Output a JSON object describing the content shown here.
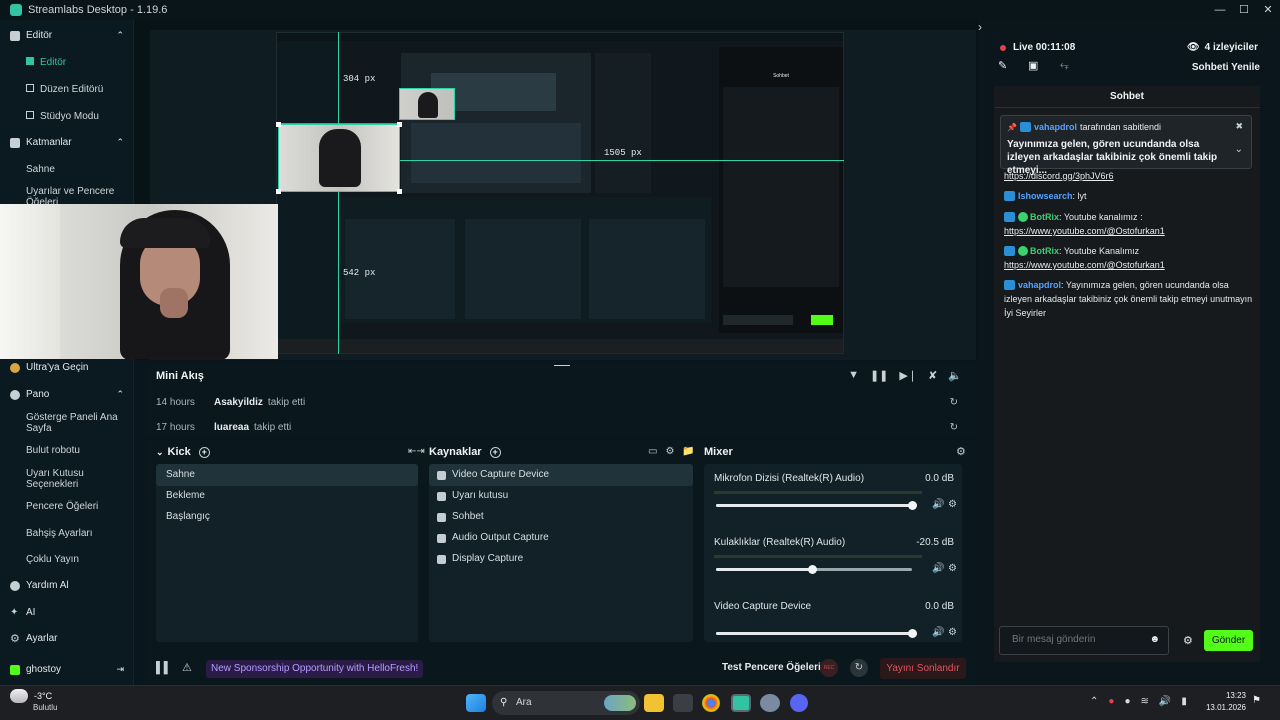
{
  "window": {
    "title": "Streamlabs Desktop - 1.19.6"
  },
  "sidebar": {
    "editor_section": "Editör",
    "editor_items": [
      "Editör",
      "Düzen Editörü",
      "Stüdyo Modu"
    ],
    "layers_section": "Katmanlar",
    "layers_items": [
      "Sahne",
      "Uyarılar ve Pencere Öğeleri"
    ],
    "ultra": "Ultra'ya Geçin",
    "panel_section": "Pano",
    "panel_items": [
      "Gösterge Paneli Ana Sayfa",
      "Bulut robotu",
      "Uyarı Kutusu Seçenekleri",
      "Pencere Öğeleri",
      "Bahşiş Ayarları",
      "Çoklu Yayın"
    ],
    "help": "Yardım Al",
    "ai": "AI",
    "settings": "Ayarlar",
    "user": "ghostoy"
  },
  "preview": {
    "guides": [
      "304 px",
      "1505 px",
      "542 px"
    ],
    "inner_chat_title": "Sohbet"
  },
  "miniflow": {
    "title": "Mini Akış",
    "rows": [
      {
        "time": "14 hours",
        "name": "Asakyildiz",
        "action": "takip etti"
      },
      {
        "time": "17 hours",
        "name": "luareaa",
        "action": "takip etti"
      }
    ]
  },
  "scenes": {
    "title": "Kick",
    "items": [
      "Sahne",
      "Bekleme",
      "Başlangıç"
    ],
    "selected": "Sahne"
  },
  "sources": {
    "title": "Kaynaklar",
    "items": [
      "Video Capture Device",
      "Uyarı kutusu",
      "Sohbet",
      "Audio Output Capture",
      "Display Capture"
    ]
  },
  "mixer": {
    "title": "Mixer",
    "channels": [
      {
        "name": "Mikrofon Dizisi (Realtek(R) Audio)",
        "db": "0.0 dB",
        "level": 1.0
      },
      {
        "name": "Kulaklıklar (Realtek(R) Audio)",
        "db": "-20.5 dB",
        "level": 0.49
      },
      {
        "name": "Video Capture Device",
        "db": "0.0 dB",
        "level": 1.0
      }
    ]
  },
  "footer": {
    "promo": "New Sponsorship Opportunity with HelloFresh!",
    "test_widgets": "Test Pencere Öğeleri",
    "rec": "REC",
    "end_stream": "Yayını Sonlandır"
  },
  "live": {
    "status": "Live 00:11:08",
    "viewers": "4 izleyiciler",
    "refresh_chat": "Sohbeti Yenile"
  },
  "chat": {
    "title": "Sohbet",
    "pinned_by": "tarafından sabitlendi",
    "pinned_user": "vahapdrol",
    "pinned_text": "Yayınımıza gelen, gören ucundanda olsa izleyen arkadaşlar takibiniz çok önemli takip etmeyi...",
    "link_discord": "https://discord.gg/3phJV6r6",
    "messages": [
      {
        "user": "Ishowsearch",
        "text": "lyt"
      },
      {
        "user": "BotRix",
        "text": "Youtube kanalımız :",
        "link": "https://www.youtube.com/@Ostofurkan1"
      },
      {
        "user": "BotRix",
        "text": "Youtube Kanalımız",
        "link": "https://www.youtube.com/@Ostofurkan1"
      },
      {
        "user": "vahapdrol",
        "text": "Yayınımıza gelen, gören ucundanda olsa izleyen arkadaşlar takibiniz çok önemli takip etmeyi unutmayın İyi Seyirler"
      }
    ],
    "input_placeholder": "Bir mesaj gönderin",
    "send": "Gönder"
  },
  "taskbar": {
    "temp": "-3°C",
    "weather": "Bulutlu",
    "search": "Ara",
    "time": "13:23",
    "date": "13.01.2026"
  }
}
